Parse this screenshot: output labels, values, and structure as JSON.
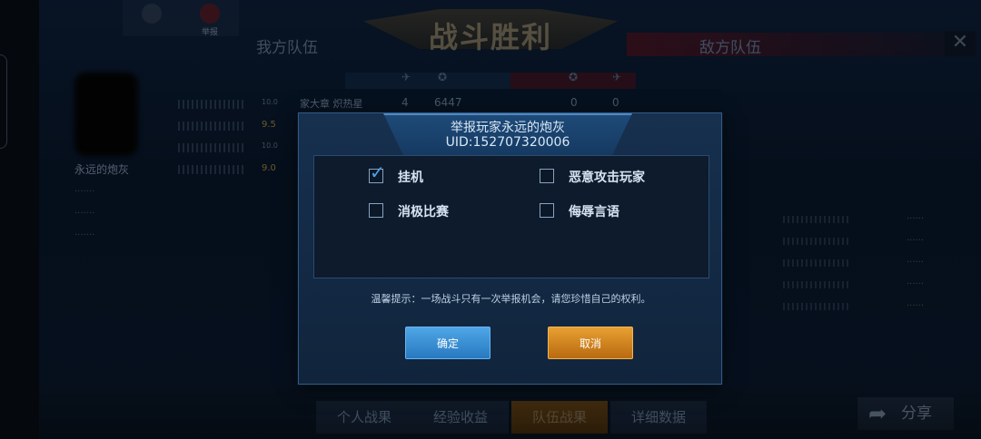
{
  "top_tabs": [
    {
      "label": "",
      "icon": "friends-icon"
    },
    {
      "label": "举报",
      "icon": "report-icon"
    }
  ],
  "banner": {
    "title": "战斗胜利"
  },
  "teams": {
    "ours": "我方队伍",
    "enemy": "敌方队伍"
  },
  "stats_header": {
    "our_kills": "4",
    "our_gold": "6447",
    "enemy_kills": "0",
    "enemy_gold": "0"
  },
  "player": {
    "name": "永远的炮灰"
  },
  "rows": [
    {
      "rating": "10.0",
      "name": "家大章 炽热星"
    },
    {
      "rating": "9.5",
      "name": ""
    },
    {
      "rating": "10.0",
      "name": ""
    },
    {
      "rating": "9.0",
      "name": ""
    }
  ],
  "dialog": {
    "title": "举报玩家永远的炮灰",
    "uid": "UID:152707320006",
    "options": [
      {
        "label": "挂机",
        "checked": true
      },
      {
        "label": "恶意攻击玩家",
        "checked": false
      },
      {
        "label": "消极比赛",
        "checked": false
      },
      {
        "label": "侮辱言语",
        "checked": false
      }
    ],
    "tip": "温馨提示：一场战斗只有一次举报机会，请您珍惜自己的权利。",
    "confirm_label": "确定",
    "cancel_label": "取消"
  },
  "bottom_tabs": [
    "个人战果",
    "经验收益",
    "队伍战果",
    "详细数据"
  ],
  "active_bottom_tab": "队伍战果",
  "share_label": "分享",
  "colors": {
    "confirm": "#2f86cf",
    "cancel": "#d08a20",
    "check": "#4fa2ea"
  }
}
